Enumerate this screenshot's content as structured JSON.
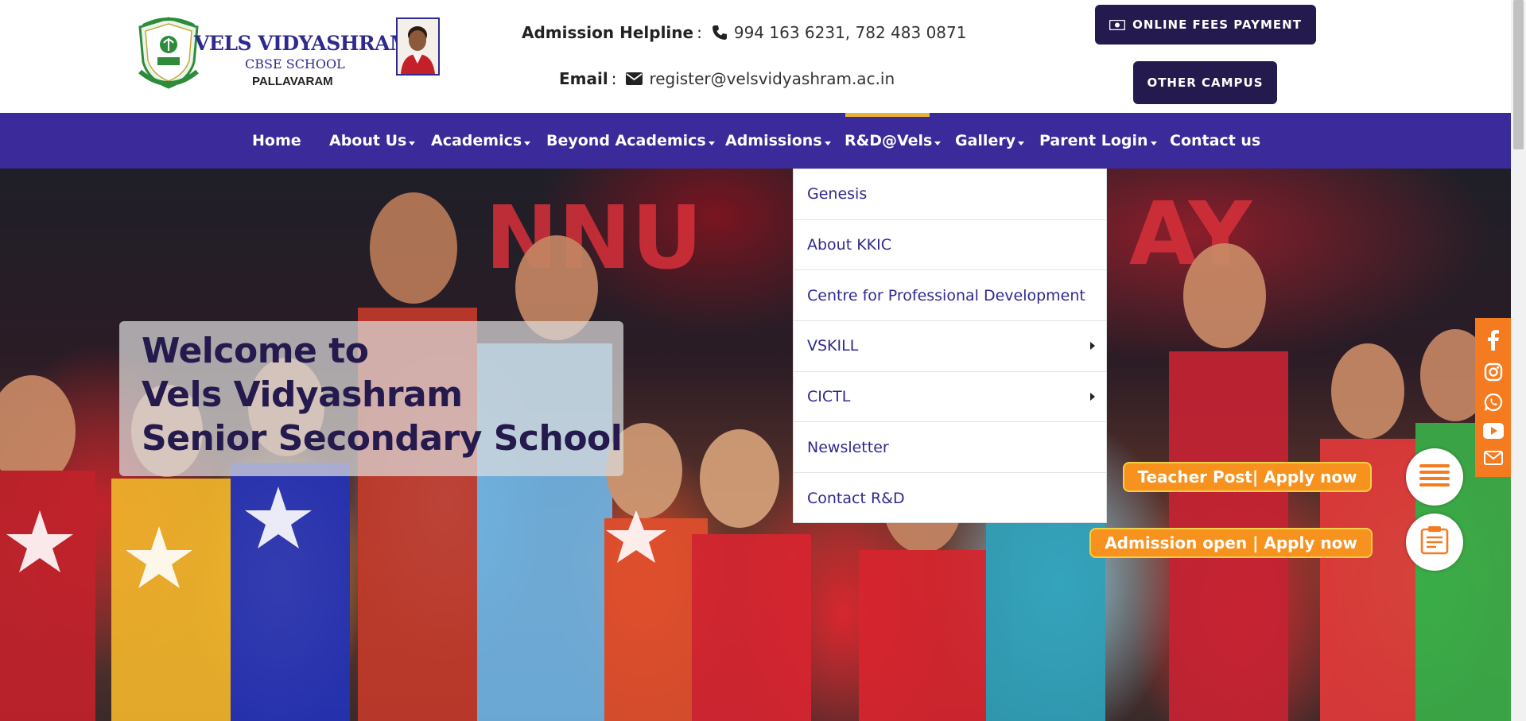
{
  "logo": {
    "title": "VELS VIDYASHRAM",
    "subtitle": "CBSE SCHOOL",
    "place": "PALLAVARAM",
    "crest_icon": "school-crest-icon",
    "portrait": "founder-portrait"
  },
  "contact": {
    "phone_label": "Admission Helpline",
    "phone_sep": ":",
    "phone_icon": "phone-icon",
    "phone_value": "994 163 6231, 782 483 0871",
    "email_label": "Email",
    "email_sep": ":",
    "email_icon": "envelope-icon",
    "email_value": "register@velsvidyashram.ac.in"
  },
  "buttons": {
    "fees_label": "ONLINE FEES PAYMENT",
    "fees_icon": "money-icon",
    "campus_label": "OTHER CAMPUS"
  },
  "nav": {
    "items": [
      {
        "label": "Home"
      },
      {
        "label": "About Us"
      },
      {
        "label": "Academics"
      },
      {
        "label": "Beyond Academics"
      },
      {
        "label": "Admissions"
      },
      {
        "label": "R&D@Vels"
      },
      {
        "label": "Gallery"
      },
      {
        "label": "Parent Login"
      },
      {
        "label": "Contact us"
      }
    ],
    "active": "R&D@Vels"
  },
  "hero": {
    "line1": "Welcome to",
    "line2": "Vels Vidyashram",
    "line3": "Senior Secondary School",
    "banner_letters": "NNU",
    "banner_letters_right": "AY"
  },
  "dropdown": {
    "items": [
      {
        "label": "Genesis",
        "has_submenu": false
      },
      {
        "label": "About KKIC",
        "has_submenu": false
      },
      {
        "label": "Centre for Professional Development",
        "has_submenu": false
      },
      {
        "label": "VSKILL",
        "has_submenu": true
      },
      {
        "label": "CICTL",
        "has_submenu": true
      },
      {
        "label": "Newsletter",
        "has_submenu": false
      },
      {
        "label": "Contact R&D",
        "has_submenu": false
      }
    ]
  },
  "social": {
    "icons": [
      "facebook-icon",
      "instagram-icon",
      "whatsapp-icon",
      "youtube-icon",
      "mail-icon"
    ],
    "color": "#f47b20"
  },
  "apply": {
    "teacher_label": "Teacher Post| Apply now",
    "teacher_icon": "menu-lines-icon",
    "admission_label": "Admission open | Apply now",
    "admission_icon": "form-icon"
  },
  "colors": {
    "nav_bg": "#3a2a9a",
    "dark_button": "#241a4d",
    "accent": "#e8b13a",
    "pill": "#f7921e"
  }
}
